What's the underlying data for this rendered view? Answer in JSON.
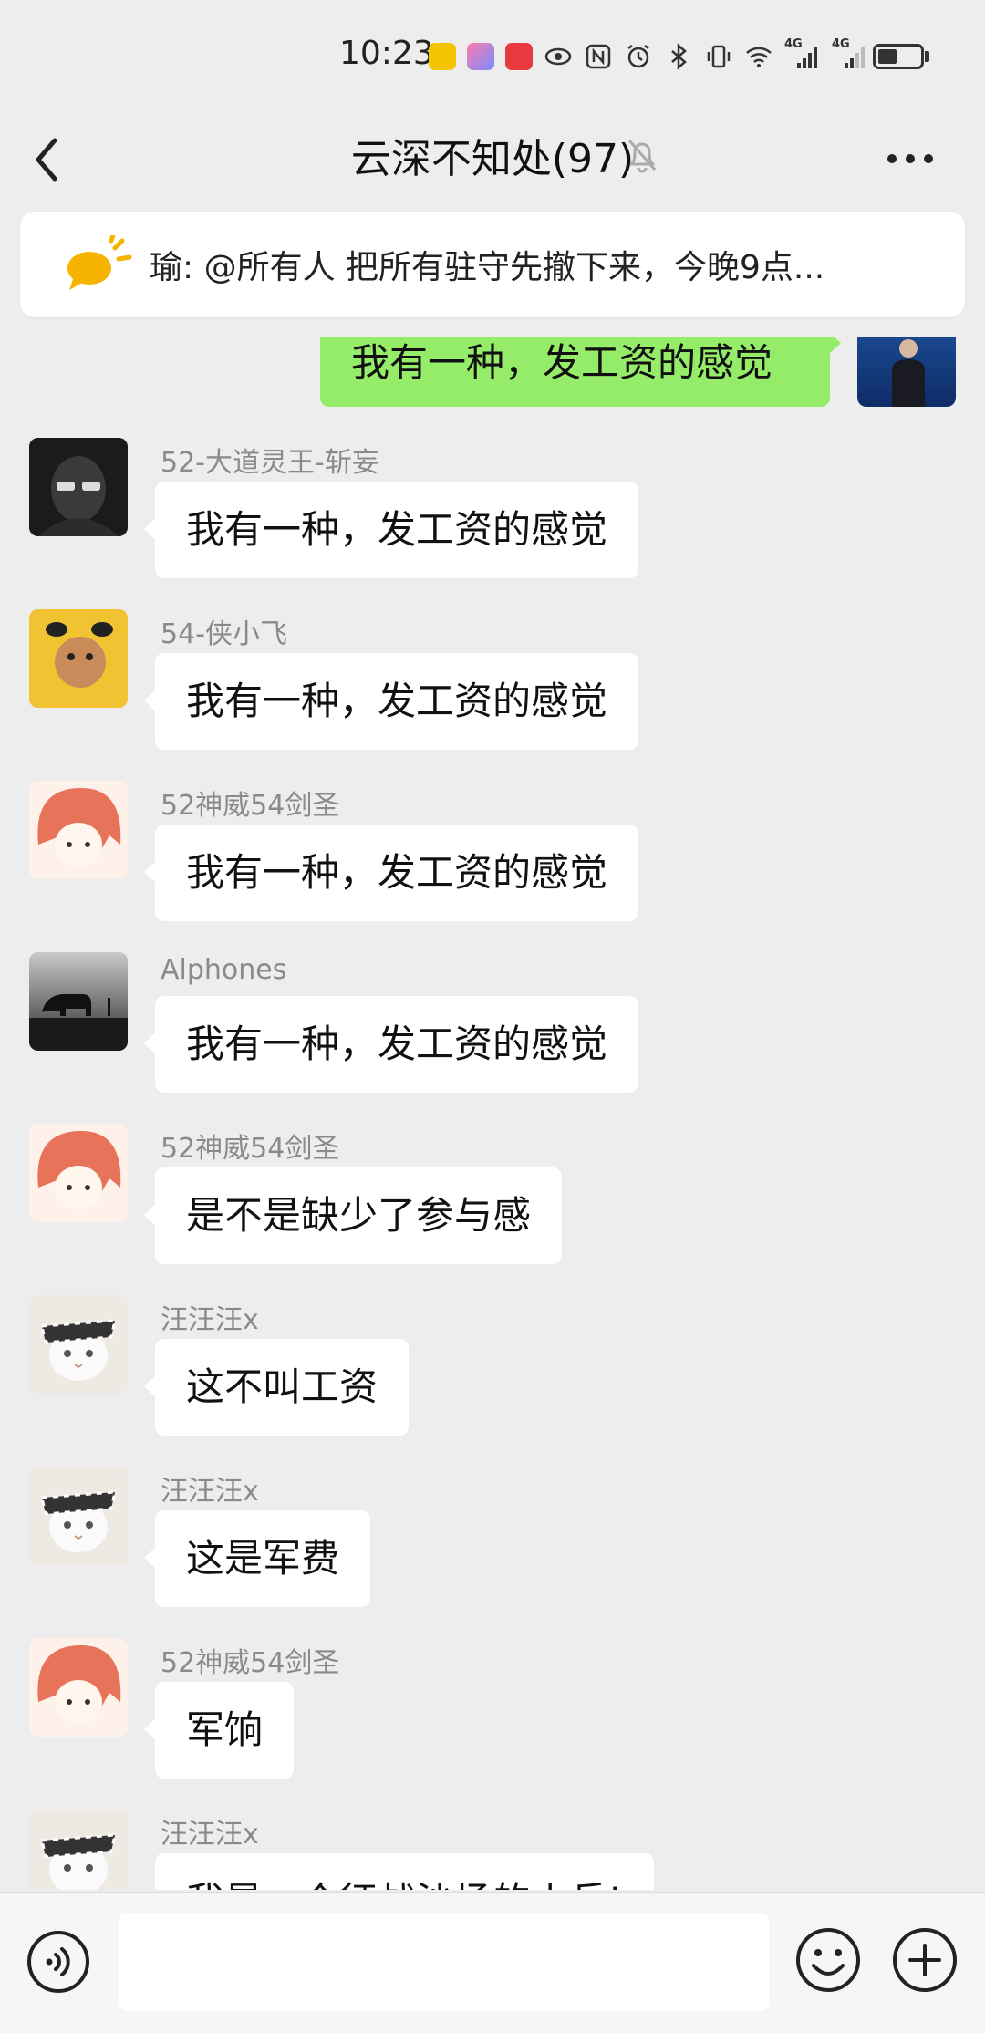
{
  "status_bar": {
    "time": "10:23",
    "app_icons": [
      "app-a-icon",
      "app-chart-icon",
      "app-red-icon"
    ],
    "app_colors": [
      "#f5c400",
      "#c56be8",
      "#e8393f"
    ],
    "system_icons": [
      "eye-icon",
      "nfc-icon",
      "alarm-icon",
      "bluetooth-icon",
      "vibrate-icon",
      "wifi-icon",
      "signal-4g-icon",
      "signal-4g-icon"
    ],
    "network_labels": [
      "4G",
      "4G"
    ],
    "battery_level": 0.45
  },
  "header": {
    "back_icon": "back-chevron-icon",
    "title": "云深不知处(97)",
    "mute_icon": "bell-muted-icon",
    "more_icon": "more-dots-icon"
  },
  "pinned": {
    "icon": "announcement-speech-icon",
    "text": "瑜: @所有人 把所有驻守先撤下来，今晚9点..."
  },
  "self_message": {
    "text": "我有一种，发工资的感觉",
    "avatar": "self-avatar-photo",
    "bubble_color": "#95ec69"
  },
  "messages": [
    {
      "sender": "52-大道灵王-斩妄",
      "text": "我有一种，发工资的感觉",
      "avatar": "dark-mask-avatar"
    },
    {
      "sender": "54-侠小飞",
      "text": "我有一种，发工资的感觉",
      "avatar": "yellow-costume-avatar"
    },
    {
      "sender": "52神威54剑圣",
      "text": "我有一种，发工资的感觉",
      "avatar": "anime-girl-avatar"
    },
    {
      "sender": "Alphones",
      "text": "我有一种，发工资的感觉",
      "avatar": "bear-silhouette-avatar"
    },
    {
      "sender": "52神威54剑圣",
      "text": "是不是缺少了参与感",
      "avatar": "anime-girl-avatar"
    },
    {
      "sender": "汪汪汪x",
      "text": "这不叫工资",
      "avatar": "cat-bandana-avatar"
    },
    {
      "sender": "汪汪汪x",
      "text": "这是军费",
      "avatar": "cat-bandana-avatar"
    },
    {
      "sender": "52神威54剑圣",
      "text": "军饷",
      "avatar": "anime-girl-avatar"
    },
    {
      "sender": "汪汪汪x",
      "text": "我是一个征战沙场的小兵!",
      "avatar": "cat-bandana-avatar"
    }
  ],
  "input_bar": {
    "voice_icon": "voice-input-icon",
    "input_value": "",
    "emoji_icon": "emoji-icon",
    "plus_icon": "plus-circle-icon"
  }
}
